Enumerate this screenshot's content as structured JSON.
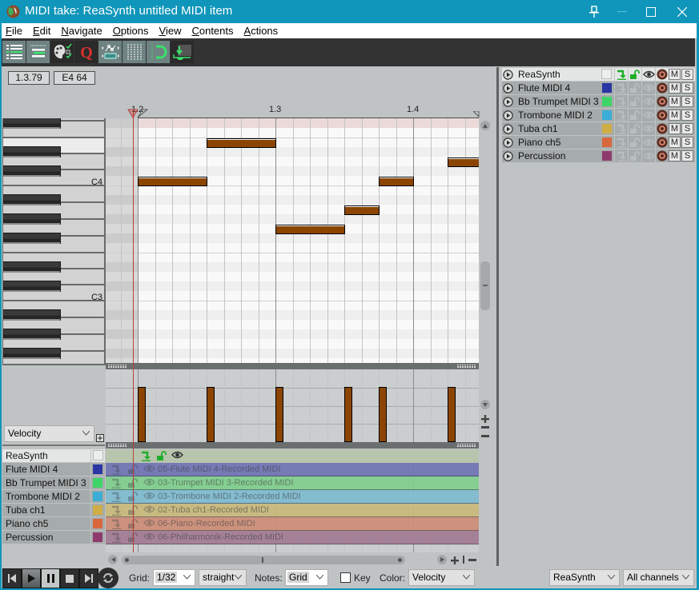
{
  "window": {
    "title": "MIDI take: ReaSynth untitled MIDI item"
  },
  "menu": {
    "items": [
      "File",
      "Edit",
      "Navigate",
      "Options",
      "View",
      "Contents",
      "Actions"
    ]
  },
  "toolbar": {
    "buttons": [
      {
        "id": "toggle-track-list",
        "icon": "track-list-icon",
        "active": true
      },
      {
        "id": "toggle-cc-lanes",
        "icon": "cc-lanes-icon",
        "active": true
      },
      {
        "id": "note-color-filter",
        "icon": "palette-checklist-icon",
        "active": false
      },
      {
        "id": "quantize",
        "icon": "quantize-q-icon",
        "active": false
      },
      {
        "id": "cc-curve-shape",
        "icon": "cc-curve-icon",
        "active": true
      },
      {
        "id": "grid-lines",
        "icon": "grid-lines-icon",
        "active": true
      },
      {
        "id": "snap",
        "icon": "magnet-icon",
        "active": true
      },
      {
        "id": "step-input",
        "icon": "step-input-icon",
        "active": false
      }
    ]
  },
  "info": {
    "position": "1.3.79",
    "note": "E4  64"
  },
  "ruler": {
    "labels": [
      {
        "text": "1.2",
        "beat": 2
      },
      {
        "text": "1.3",
        "beat": 3
      },
      {
        "text": "1.4",
        "beat": 4
      }
    ]
  },
  "keyboard": {
    "labels": [
      {
        "text": "C4",
        "midi": 60
      },
      {
        "text": "C3",
        "midi": 48
      }
    ],
    "hovered_key": "E4"
  },
  "piano_roll": {
    "grid": "1/32",
    "highlighted_row": "F#4",
    "note_color": "#8b4500",
    "playhead_beat": 1.965,
    "notes": [
      {
        "pitch": "C4",
        "midi": 60,
        "position": "1.2.00",
        "beat": 2.0,
        "length_beats": 0.5,
        "velocity": 96
      },
      {
        "pitch": "E4",
        "midi": 64,
        "position": "1.2.50",
        "beat": 2.5,
        "length_beats": 0.5,
        "velocity": 96
      },
      {
        "pitch": "G3",
        "midi": 55,
        "position": "1.3.00",
        "beat": 3.0,
        "length_beats": 0.5,
        "velocity": 96
      },
      {
        "pitch": "A3",
        "midi": 57,
        "position": "1.3.50",
        "beat": 3.5,
        "length_beats": 0.25,
        "velocity": 96
      },
      {
        "pitch": "C4",
        "midi": 60,
        "position": "1.3.75",
        "beat": 3.75,
        "length_beats": 0.25,
        "velocity": 96
      },
      {
        "pitch": "D4",
        "midi": 62,
        "position": "1.4.25",
        "beat": 4.25,
        "length_beats": 0.25,
        "velocity": 96
      }
    ]
  },
  "cc_lane": {
    "selector": "Velocity"
  },
  "tracks": {
    "header": {
      "name": "ReaSynth"
    },
    "mute_label": "M",
    "solo_label": "S",
    "items": [
      {
        "name": "Flute MIDI 4",
        "color": "#2b35a3",
        "item": "05-Flute MIDI 4-Recorded MIDI",
        "item_color": "#7074b4"
      },
      {
        "name": "Bb Trumpet MIDI 3",
        "color": "#3fd468",
        "item": "03-Trumpet MIDI 3-Recorded MIDI",
        "item_color": "#80cf8d"
      },
      {
        "name": "Trombone MIDI 2",
        "color": "#3badd6",
        "item": "03-Trombone MIDI 2-Recorded MIDI",
        "item_color": "#7fbbd1"
      },
      {
        "name": "Tuba ch1",
        "color": "#d0ae47",
        "item": "02-Tuba ch1-Recorded MIDI",
        "item_color": "#c8b97b"
      },
      {
        "name": "Piano ch5",
        "color": "#d9673e",
        "item": "06-Piano-Recorded MIDI",
        "item_color": "#cd8e78"
      },
      {
        "name": "Percussion",
        "color": "#8e3a6c",
        "item": "06-Philharmonik-Recorded MIDI",
        "item_color": "#a37b94"
      }
    ]
  },
  "bottom": {
    "grid_label": "Grid:",
    "grid_value": "1/32",
    "swing_value": "straight",
    "notes_label": "Notes:",
    "notes_value": "Grid",
    "key_label": "Key",
    "key_checked": false,
    "color_label": "Color:",
    "color_value": "Velocity",
    "track_value": "ReaSynth",
    "channel_value": "All channels"
  }
}
